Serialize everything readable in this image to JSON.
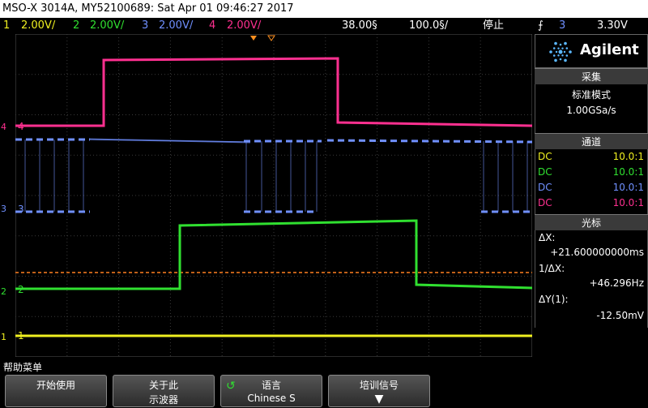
{
  "title": "MSO-X 3014A, MY52100689: Sat Apr 01 09:46:27 2017",
  "channels_bar": {
    "ch1": {
      "num": "1",
      "scale": "2.00V/",
      "color": "#f0f020"
    },
    "ch2": {
      "num": "2",
      "scale": "2.00V/",
      "color": "#30e030"
    },
    "ch3": {
      "num": "3",
      "scale": "2.00V/",
      "color": "#7090ff"
    },
    "ch4": {
      "num": "4",
      "scale": "2.00V/",
      "color": "#ff3090"
    },
    "timebase": "38.00§",
    "delay": "100.0§/",
    "run_state": "停止",
    "trigger_channel": "3",
    "trigger_level": "3.30V"
  },
  "brand": {
    "name": "Agilent",
    "icon": "agilent-spark-icon"
  },
  "acquisition": {
    "header": "采集",
    "mode": "标准模式",
    "rate": "1.00GSa/s"
  },
  "channels_panel": {
    "header": "通道",
    "rows": [
      {
        "coupling": "DC",
        "probe": "10.0:1",
        "color": "#f0f020"
      },
      {
        "coupling": "DC",
        "probe": "10.0:1",
        "color": "#30e030"
      },
      {
        "coupling": "DC",
        "probe": "10.0:1",
        "color": "#7090ff"
      },
      {
        "coupling": "DC",
        "probe": "10.0:1",
        "color": "#ff3090"
      }
    ]
  },
  "cursors": {
    "header": "光标",
    "dx_label": "ΔX:",
    "dx_value": "+21.600000000ms",
    "inv_dx_label": "1/ΔX:",
    "inv_dx_value": "+46.296Hz",
    "dy_label": "ΔY(1):",
    "dy_value": "-12.50mV"
  },
  "trace_labels": {
    "ch1": "1",
    "ch2": "2",
    "ch3": "3",
    "ch4": "4"
  },
  "help_menu": "帮助菜单",
  "softkeys": [
    {
      "l1": "开始使用",
      "l2": ""
    },
    {
      "l1": "关于此",
      "l2": "示波器"
    },
    {
      "l1": "语言",
      "l2": "Chinese S"
    },
    {
      "l1": "培训信号",
      "l2": ""
    }
  ]
}
